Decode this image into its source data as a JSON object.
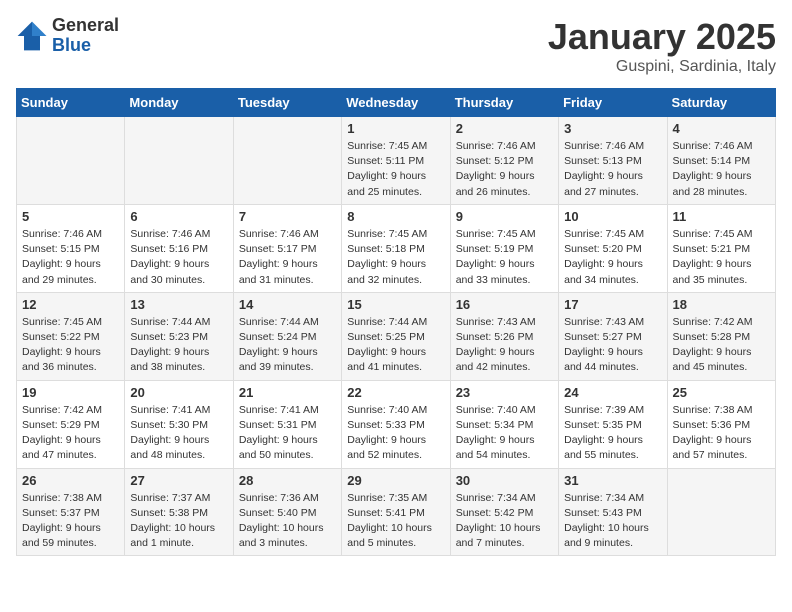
{
  "header": {
    "logo_general": "General",
    "logo_blue": "Blue",
    "month": "January 2025",
    "location": "Guspini, Sardinia, Italy"
  },
  "weekdays": [
    "Sunday",
    "Monday",
    "Tuesday",
    "Wednesday",
    "Thursday",
    "Friday",
    "Saturday"
  ],
  "weeks": [
    [
      {
        "day": "",
        "info": ""
      },
      {
        "day": "",
        "info": ""
      },
      {
        "day": "",
        "info": ""
      },
      {
        "day": "1",
        "info": "Sunrise: 7:45 AM\nSunset: 5:11 PM\nDaylight: 9 hours and 25 minutes."
      },
      {
        "day": "2",
        "info": "Sunrise: 7:46 AM\nSunset: 5:12 PM\nDaylight: 9 hours and 26 minutes."
      },
      {
        "day": "3",
        "info": "Sunrise: 7:46 AM\nSunset: 5:13 PM\nDaylight: 9 hours and 27 minutes."
      },
      {
        "day": "4",
        "info": "Sunrise: 7:46 AM\nSunset: 5:14 PM\nDaylight: 9 hours and 28 minutes."
      }
    ],
    [
      {
        "day": "5",
        "info": "Sunrise: 7:46 AM\nSunset: 5:15 PM\nDaylight: 9 hours and 29 minutes."
      },
      {
        "day": "6",
        "info": "Sunrise: 7:46 AM\nSunset: 5:16 PM\nDaylight: 9 hours and 30 minutes."
      },
      {
        "day": "7",
        "info": "Sunrise: 7:46 AM\nSunset: 5:17 PM\nDaylight: 9 hours and 31 minutes."
      },
      {
        "day": "8",
        "info": "Sunrise: 7:45 AM\nSunset: 5:18 PM\nDaylight: 9 hours and 32 minutes."
      },
      {
        "day": "9",
        "info": "Sunrise: 7:45 AM\nSunset: 5:19 PM\nDaylight: 9 hours and 33 minutes."
      },
      {
        "day": "10",
        "info": "Sunrise: 7:45 AM\nSunset: 5:20 PM\nDaylight: 9 hours and 34 minutes."
      },
      {
        "day": "11",
        "info": "Sunrise: 7:45 AM\nSunset: 5:21 PM\nDaylight: 9 hours and 35 minutes."
      }
    ],
    [
      {
        "day": "12",
        "info": "Sunrise: 7:45 AM\nSunset: 5:22 PM\nDaylight: 9 hours and 36 minutes."
      },
      {
        "day": "13",
        "info": "Sunrise: 7:44 AM\nSunset: 5:23 PM\nDaylight: 9 hours and 38 minutes."
      },
      {
        "day": "14",
        "info": "Sunrise: 7:44 AM\nSunset: 5:24 PM\nDaylight: 9 hours and 39 minutes."
      },
      {
        "day": "15",
        "info": "Sunrise: 7:44 AM\nSunset: 5:25 PM\nDaylight: 9 hours and 41 minutes."
      },
      {
        "day": "16",
        "info": "Sunrise: 7:43 AM\nSunset: 5:26 PM\nDaylight: 9 hours and 42 minutes."
      },
      {
        "day": "17",
        "info": "Sunrise: 7:43 AM\nSunset: 5:27 PM\nDaylight: 9 hours and 44 minutes."
      },
      {
        "day": "18",
        "info": "Sunrise: 7:42 AM\nSunset: 5:28 PM\nDaylight: 9 hours and 45 minutes."
      }
    ],
    [
      {
        "day": "19",
        "info": "Sunrise: 7:42 AM\nSunset: 5:29 PM\nDaylight: 9 hours and 47 minutes."
      },
      {
        "day": "20",
        "info": "Sunrise: 7:41 AM\nSunset: 5:30 PM\nDaylight: 9 hours and 48 minutes."
      },
      {
        "day": "21",
        "info": "Sunrise: 7:41 AM\nSunset: 5:31 PM\nDaylight: 9 hours and 50 minutes."
      },
      {
        "day": "22",
        "info": "Sunrise: 7:40 AM\nSunset: 5:33 PM\nDaylight: 9 hours and 52 minutes."
      },
      {
        "day": "23",
        "info": "Sunrise: 7:40 AM\nSunset: 5:34 PM\nDaylight: 9 hours and 54 minutes."
      },
      {
        "day": "24",
        "info": "Sunrise: 7:39 AM\nSunset: 5:35 PM\nDaylight: 9 hours and 55 minutes."
      },
      {
        "day": "25",
        "info": "Sunrise: 7:38 AM\nSunset: 5:36 PM\nDaylight: 9 hours and 57 minutes."
      }
    ],
    [
      {
        "day": "26",
        "info": "Sunrise: 7:38 AM\nSunset: 5:37 PM\nDaylight: 9 hours and 59 minutes."
      },
      {
        "day": "27",
        "info": "Sunrise: 7:37 AM\nSunset: 5:38 PM\nDaylight: 10 hours and 1 minute."
      },
      {
        "day": "28",
        "info": "Sunrise: 7:36 AM\nSunset: 5:40 PM\nDaylight: 10 hours and 3 minutes."
      },
      {
        "day": "29",
        "info": "Sunrise: 7:35 AM\nSunset: 5:41 PM\nDaylight: 10 hours and 5 minutes."
      },
      {
        "day": "30",
        "info": "Sunrise: 7:34 AM\nSunset: 5:42 PM\nDaylight: 10 hours and 7 minutes."
      },
      {
        "day": "31",
        "info": "Sunrise: 7:34 AM\nSunset: 5:43 PM\nDaylight: 10 hours and 9 minutes."
      },
      {
        "day": "",
        "info": ""
      }
    ]
  ]
}
